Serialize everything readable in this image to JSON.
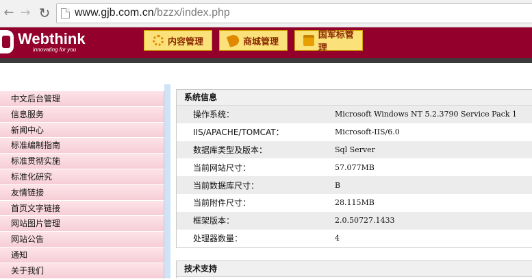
{
  "browser": {
    "url_host": "www.gjb.com.cn",
    "url_path": "/bzzx/index.php"
  },
  "header": {
    "logo_text": "Webthink",
    "logo_tagline": "innovating for you",
    "buttons": [
      {
        "label": "内容管理",
        "icon": "gear-icon"
      },
      {
        "label": "商城管理",
        "icon": "tag-icon"
      },
      {
        "label": "国军标管理",
        "icon": "folder-icon"
      }
    ],
    "brand_color": "#93002b"
  },
  "sidebar": {
    "items": [
      "中文后台管理",
      "信息服务",
      "新闻中心",
      "标准编制指南",
      "标准贯彻实施",
      "标准化研究",
      "友情链接",
      "首页文字链接",
      "网站图片管理",
      "网站公告",
      "通知",
      "关于我们"
    ]
  },
  "system_info": {
    "title": "系统信息",
    "rows": [
      {
        "label": "操作系统：",
        "value": "Microsoft Windows NT 5.2.3790 Service Pack 1"
      },
      {
        "label": "IIS/APACHE/TOMCAT：",
        "value": "Microsoft-IIS/6.0"
      },
      {
        "label": "数据库类型及版本：",
        "value": "Sql Server"
      },
      {
        "label": "当前网站尺寸：",
        "value": "57.077MB"
      },
      {
        "label": "当前数据库尺寸：",
        "value": "B"
      },
      {
        "label": "当前附件尺寸：",
        "value": "28.115MB"
      },
      {
        "label": "框架版本：",
        "value": "2.0.50727.1433"
      },
      {
        "label": "处理器数量：",
        "value": "4"
      }
    ]
  },
  "tech_support": {
    "title": "技术支持"
  }
}
